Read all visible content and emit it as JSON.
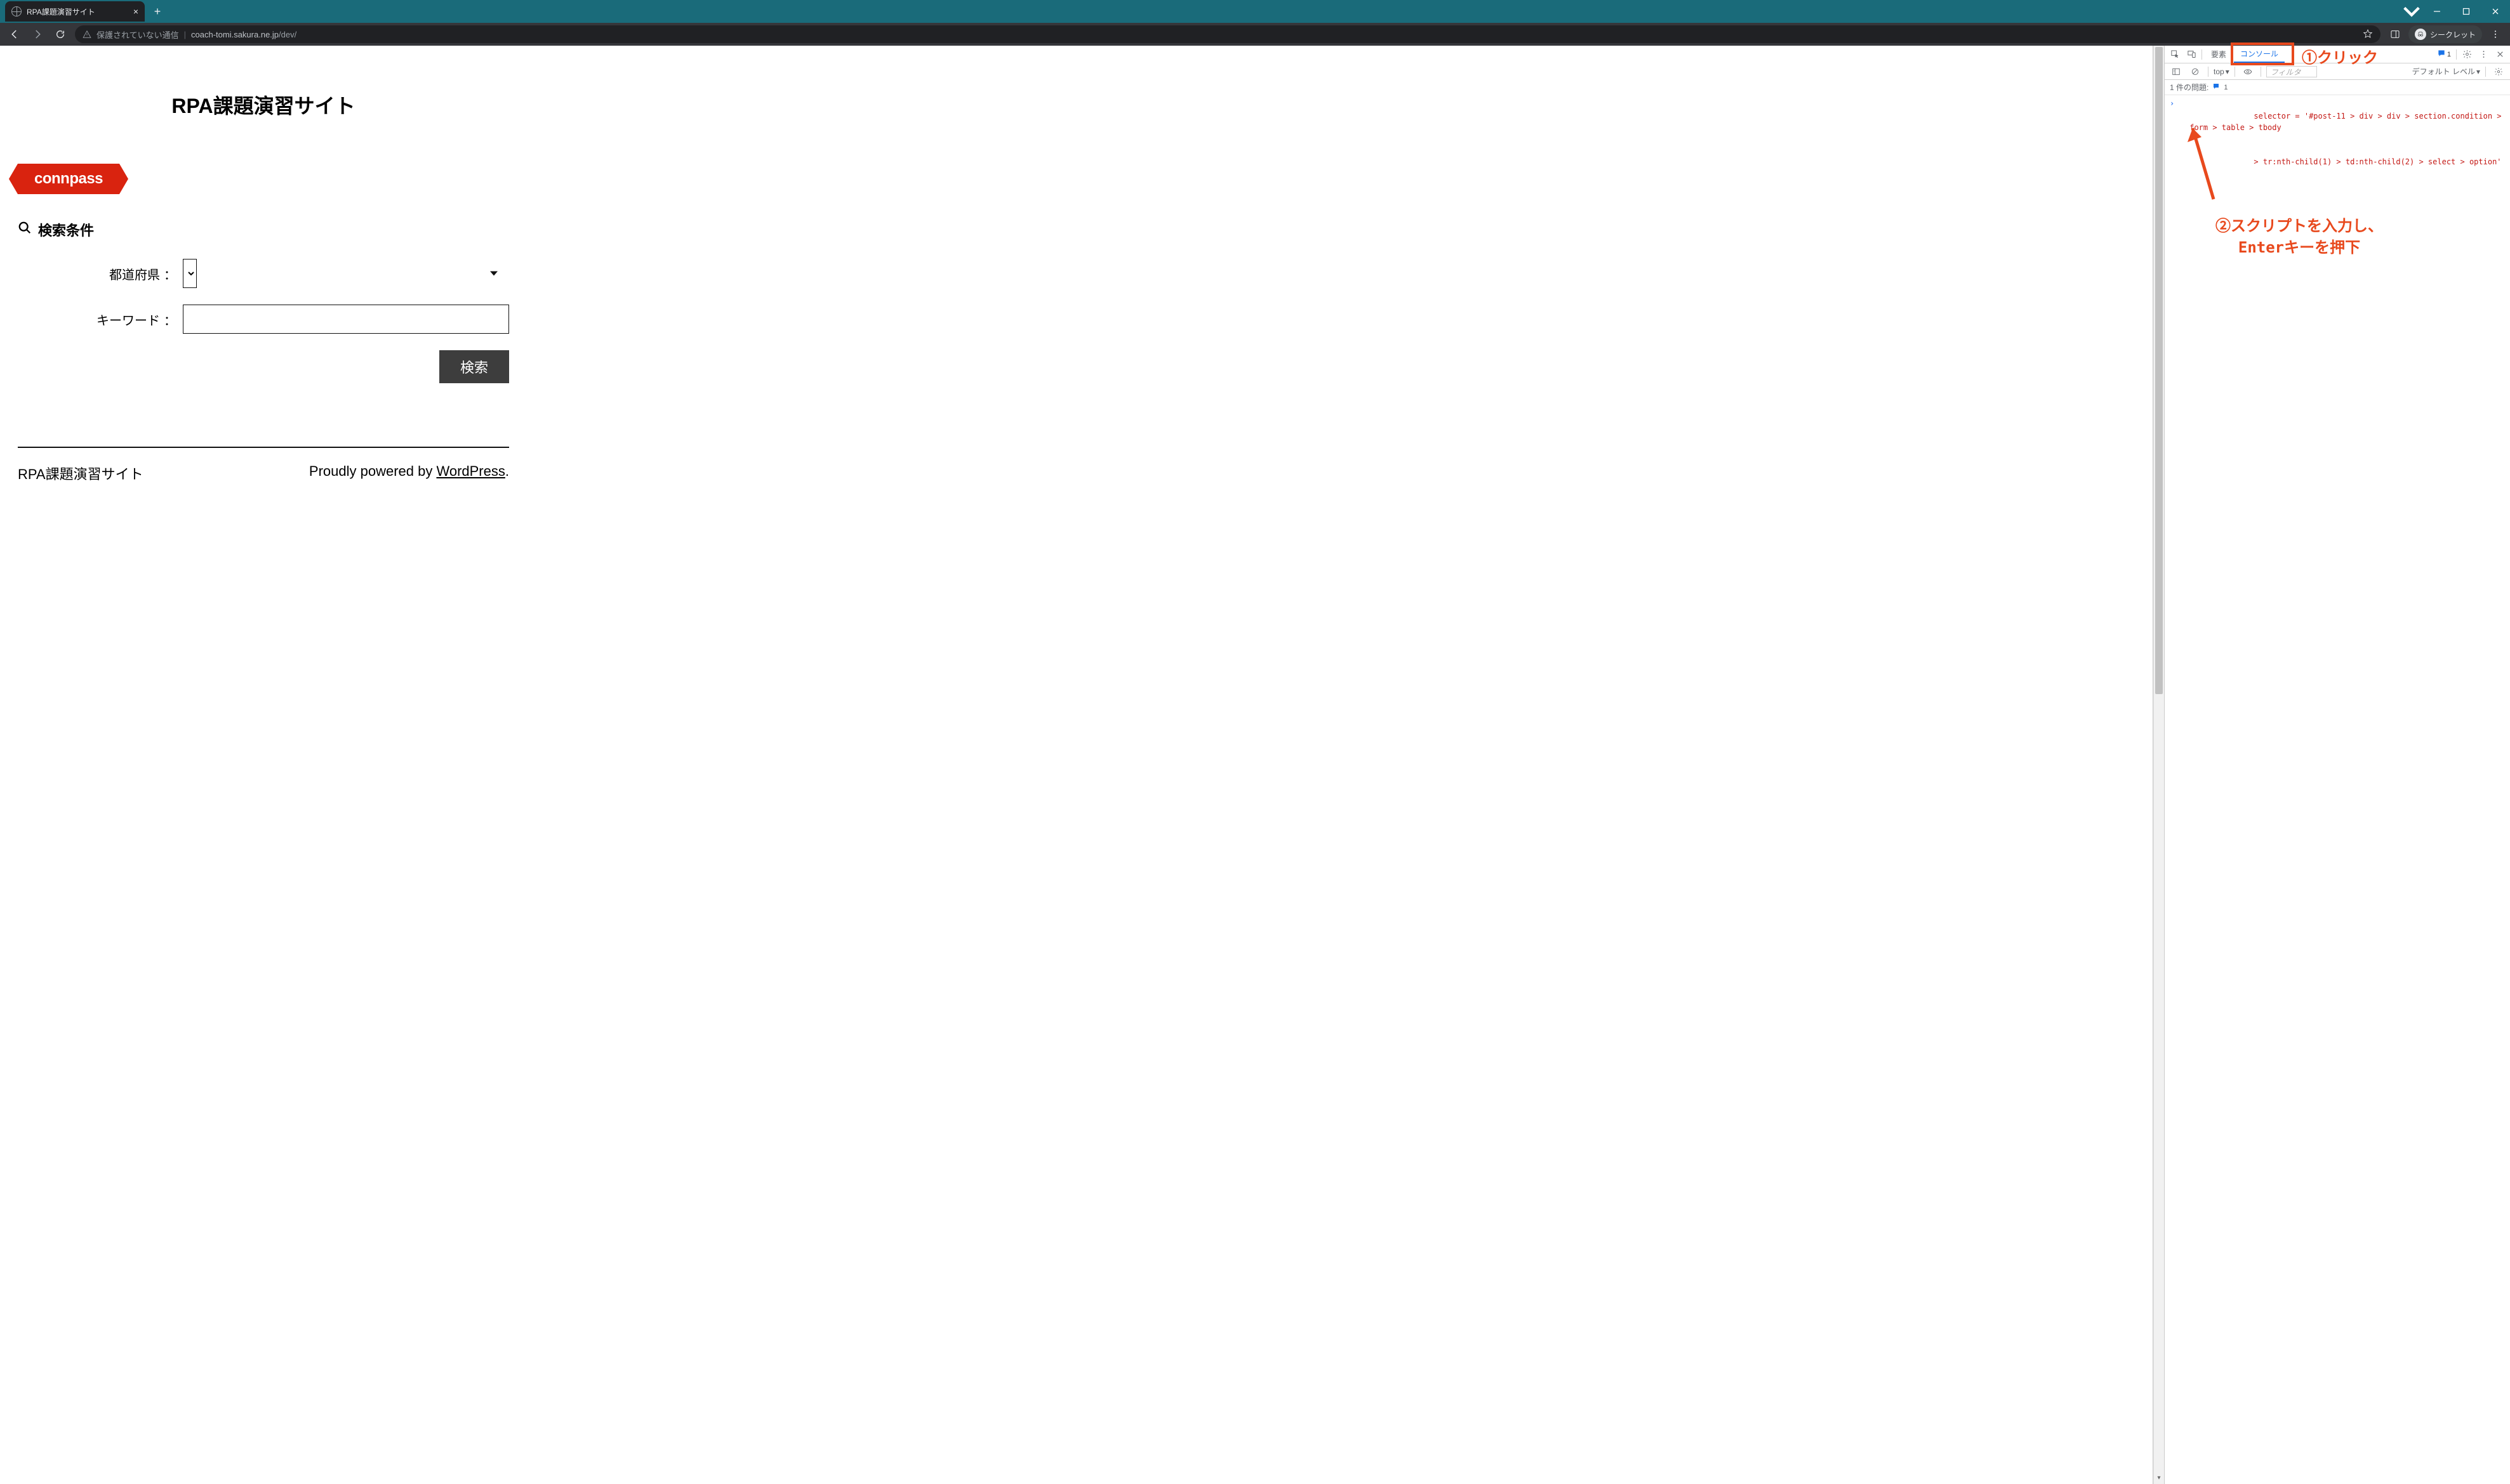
{
  "browser": {
    "tab_title": "RPA課題演習サイト",
    "new_tab_plus": "+",
    "addr_warning_text": "保護されていない通信",
    "addr_domain": "coach-tomi.sakura.ne.jp",
    "addr_path": "/dev/",
    "incognito_label": "シークレット"
  },
  "page": {
    "heading": "RPA課題演習サイト",
    "logo_text": "connpass",
    "search_heading": "検索条件",
    "labels": {
      "prefecture": "都道府県",
      "keyword": "キーワード"
    },
    "colon": "：",
    "search_button": "検索",
    "footer_site": "RPA課題演習サイト",
    "footer_powered_prefix": "Proudly powered by ",
    "footer_powered_link": "WordPress",
    "footer_powered_suffix": "."
  },
  "devtools": {
    "tabs": {
      "elements": "要素",
      "console": "コンソール"
    },
    "toolbar": {
      "context": "top",
      "filter_placeholder": "フィルタ",
      "level_label": "デフォルト レベル"
    },
    "issues": {
      "text": "1 件の問題:",
      "count": "1"
    },
    "right_badge_count": "1",
    "console_code_line1": "selector = '#post-11 > div > div > section.condition > form > table > tbody",
    "console_code_line2": "> tr:nth-child(1) > td:nth-child(2) > select > option'"
  },
  "annotations": {
    "click": "①クリック",
    "script_line1": "②スクリプトを入力し、",
    "script_line2": "Enterキーを押下"
  }
}
